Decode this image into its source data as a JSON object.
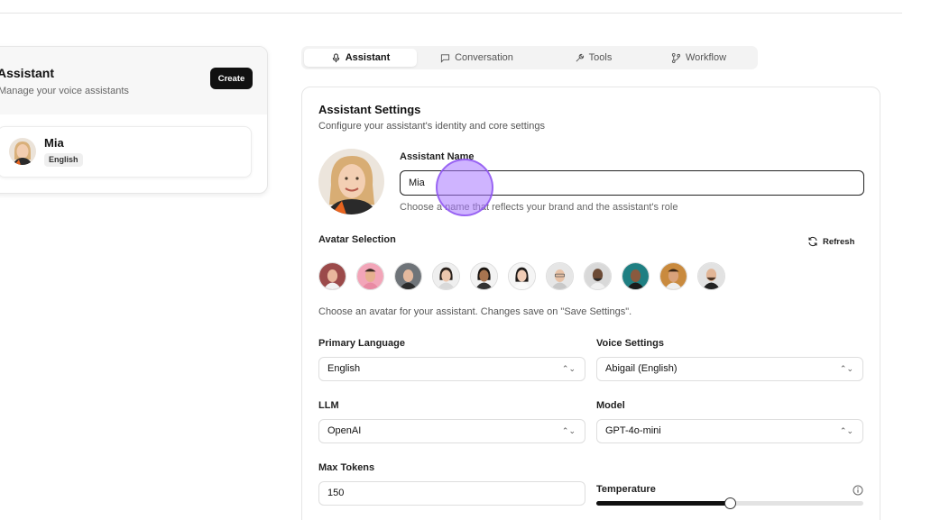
{
  "left_panel": {
    "title": "Assistant",
    "subtitle": "Manage your voice assistants",
    "create_label": "Create",
    "assistants": [
      {
        "name": "Mia",
        "language": "English"
      }
    ]
  },
  "tabs": [
    {
      "label": "Assistant",
      "icon": "mic-icon",
      "active": true
    },
    {
      "label": "Conversation",
      "icon": "chat-icon",
      "active": false
    },
    {
      "label": "Tools",
      "icon": "wrench-icon",
      "active": false
    },
    {
      "label": "Workflow",
      "icon": "workflow-icon",
      "active": false
    }
  ],
  "settings": {
    "title": "Assistant Settings",
    "subtitle": "Configure your assistant's identity and core settings",
    "name_label": "Assistant Name",
    "name_value": "Mia",
    "name_hint": "Choose a name that reflects your brand and the assistant's role",
    "avatar_label": "Avatar Selection",
    "refresh_label": "Refresh",
    "avatar_hint": "Choose an avatar for your assistant. Changes save on \"Save Settings\".",
    "avatar_count": 11,
    "primary_language_label": "Primary Language",
    "primary_language_value": "English",
    "voice_label": "Voice Settings",
    "voice_value": "Abigail (English)",
    "llm_label": "LLM",
    "llm_value": "OpenAI",
    "model_label": "Model",
    "model_value": "GPT-4o-mini",
    "max_tokens_label": "Max Tokens",
    "max_tokens_value": "150",
    "temperature_label": "Temperature",
    "temperature_fraction": 0.5
  },
  "colors": {
    "accent": "#111111",
    "cursor": "#a776ff"
  }
}
